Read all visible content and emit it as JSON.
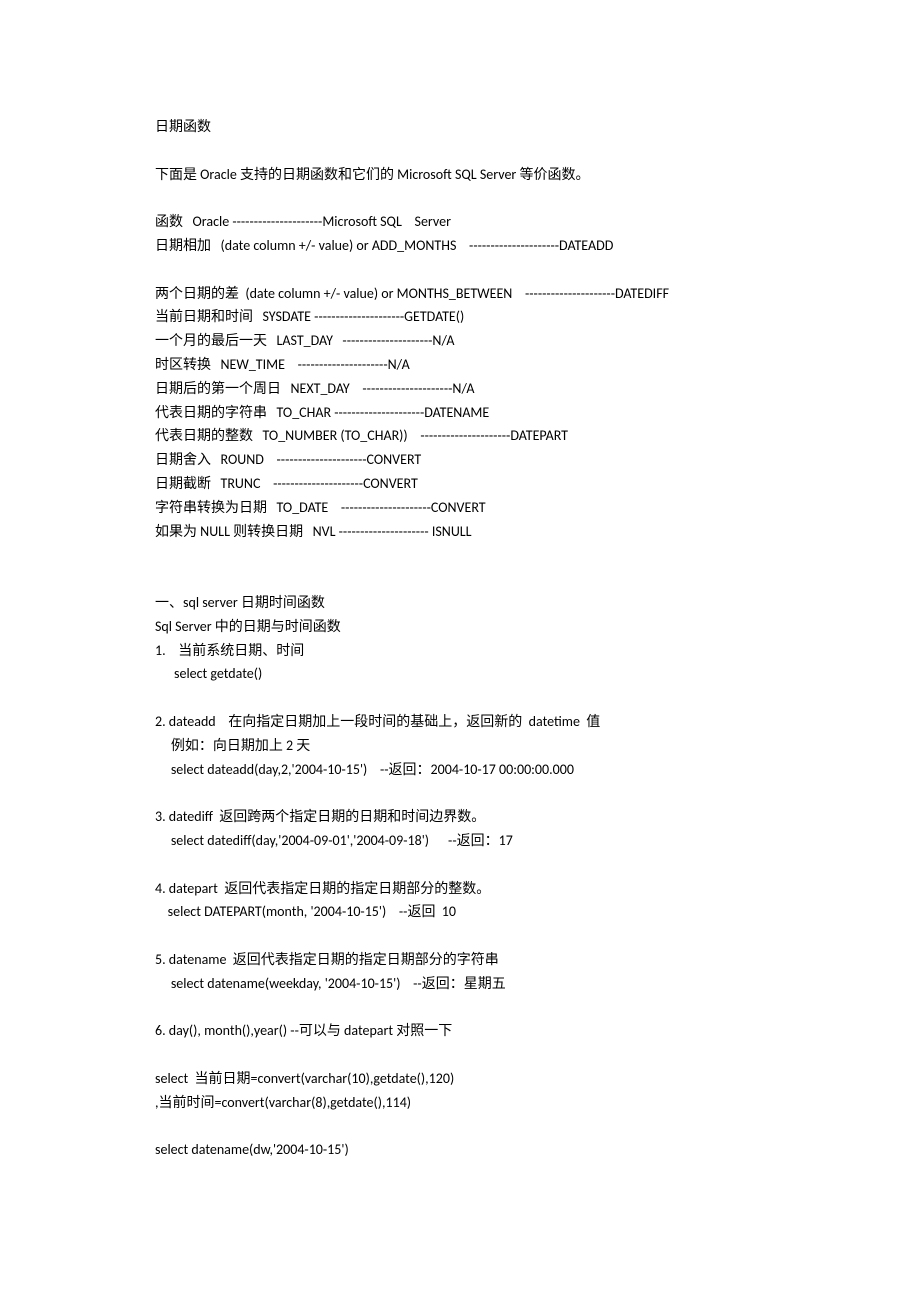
{
  "title": "日期函数",
  "intro": "下面是 Oracle 支持的日期函数和它们的 Microsoft SQL Server 等价函数。",
  "functions": {
    "header": "函数   Oracle ---------------------Microsoft SQL    Server",
    "rows": [
      "日期相加   (date column +/- value) or ADD_MONTHS    ---------------------DATEADD ",
      "",
      "两个日期的差  (date column +/- value) or MONTHS_BETWEEN    ---------------------DATEDIFF ",
      "当前日期和时间   SYSDATE ---------------------GETDATE() ",
      "一个月的最后一天   LAST_DAY   ---------------------N/A ",
      "时区转换   NEW_TIME    ---------------------N/A ",
      "日期后的第一个周日   NEXT_DAY    ---------------------N/A ",
      "代表日期的字符串   TO_CHAR ---------------------DATENAME ",
      "代表日期的整数   TO_NUMBER (TO_CHAR))    ---------------------DATEPART ",
      "日期舍入   ROUND    ---------------------CONVERT ",
      "日期截断   TRUNC    ---------------------CONVERT ",
      "字符串转换为日期   TO_DATE    ---------------------CONVERT ",
      "如果为 NULL 则转换日期   NVL --------------------- ISNULL "
    ]
  },
  "section1_title": "一、sql server 日期时间函数",
  "section1_sub": "Sql Server 中的日期与时间函数",
  "items": [
    {
      "lines": [
        "1.    当前系统日期、时间",
        "      select getdate()"
      ]
    },
    {
      "lines": [
        "2. dateadd    在向指定日期加上一段时间的基础上，返回新的  datetime  值",
        "     例如：向日期加上 2 天",
        "     select dateadd(day,2,'2004-10-15')    --返回：2004-10-17 00:00:00.000 "
      ]
    },
    {
      "lines": [
        "3. datediff  返回跨两个指定日期的日期和时间边界数。",
        "     select datediff(day,'2004-09-01','2004-09-18')      --返回：17 "
      ]
    },
    {
      "lines": [
        "4. datepart  返回代表指定日期的指定日期部分的整数。",
        "    select DATEPART(month, '2004-10-15')    --返回  10 "
      ]
    },
    {
      "lines": [
        "5. datename  返回代表指定日期的指定日期部分的字符串",
        "     select datename(weekday, '2004-10-15')    --返回：星期五 "
      ]
    },
    {
      "lines": [
        "6. day(), month(),year() --可以与 datepart 对照一下"
      ]
    }
  ],
  "snippets": [
    "select  当前日期=convert(varchar(10),getdate(),120)",
    ",当前时间=convert(varchar(8),getdate(),114) ",
    "",
    "select datename(dw,'2004-10-15')"
  ]
}
